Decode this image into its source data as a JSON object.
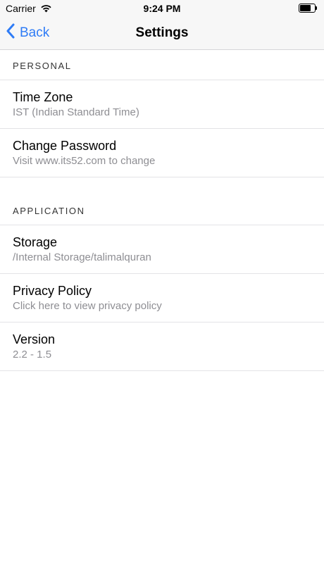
{
  "status_bar": {
    "carrier": "Carrier",
    "time": "9:24 PM",
    "wifi_icon": "wifi-icon",
    "battery_icon": "battery-icon"
  },
  "nav": {
    "back_label": "Back",
    "back_icon": "chevron-left-icon",
    "title": "Settings",
    "accent_color": "#2f7cf6"
  },
  "sections": [
    {
      "header": "PERSONAL",
      "items": [
        {
          "title": "Time Zone",
          "subtitle": "IST (Indian Standard Time)"
        },
        {
          "title": "Change Password",
          "subtitle": "Visit www.its52.com to change"
        }
      ]
    },
    {
      "header": "APPLICATION",
      "items": [
        {
          "title": "Storage",
          "subtitle": "/Internal Storage/talimalquran"
        },
        {
          "title": "Privacy Policy",
          "subtitle": "Click here to view privacy policy"
        },
        {
          "title": "Version",
          "subtitle": "2.2 - 1.5"
        }
      ]
    }
  ]
}
